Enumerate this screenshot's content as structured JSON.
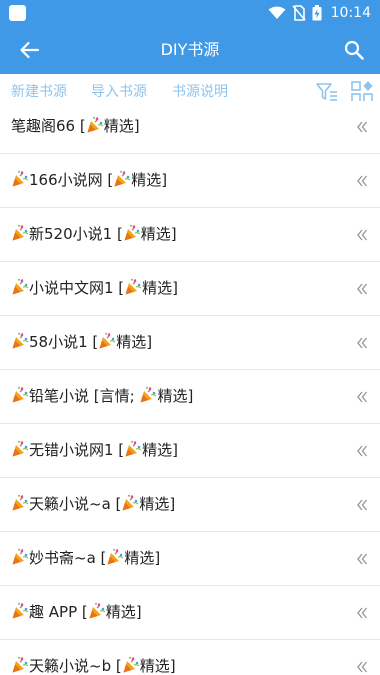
{
  "status": {
    "time": "10:14"
  },
  "toolbar": {
    "title": "DIY书源"
  },
  "actions": {
    "new_source": "新建书源",
    "import_source": "导入书源",
    "source_help": "书源说明"
  },
  "sources": [
    {
      "name": "笔趣阁66 [",
      "tag": "精选]",
      "emoji": false
    },
    {
      "name": "166小说网 [",
      "tag": "精选]",
      "emoji": true
    },
    {
      "name": "新520小说1 [",
      "tag": "精选]",
      "emoji": true
    },
    {
      "name": "小说中文网1 [",
      "tag": "精选]",
      "emoji": true
    },
    {
      "name": "58小说1 [",
      "tag": "精选]",
      "emoji": true
    },
    {
      "name": "铅笔小说 [言情; ",
      "tag": "精选]",
      "emoji": true
    },
    {
      "name": "无错小说网1 [",
      "tag": "精选]",
      "emoji": true
    },
    {
      "name": "天籁小说~a [",
      "tag": "精选]",
      "emoji": true
    },
    {
      "name": "妙书斋~a [",
      "tag": "精选]",
      "emoji": true
    },
    {
      "name": "趣 APP [",
      "tag": "精选]",
      "emoji": true
    },
    {
      "name": "天籁小说~b [",
      "tag": "精选]",
      "emoji": true
    }
  ],
  "icons": {
    "back": "arrow-left-icon",
    "search": "search-icon",
    "filter": "filter-icon",
    "grid": "grid-plus-icon",
    "row_action": "double-chevron-left-icon",
    "tag": "party-popper-icon"
  },
  "colors": {
    "appbar": "#3f99e6",
    "action_link": "#8fc4ee",
    "text": "#222222"
  }
}
